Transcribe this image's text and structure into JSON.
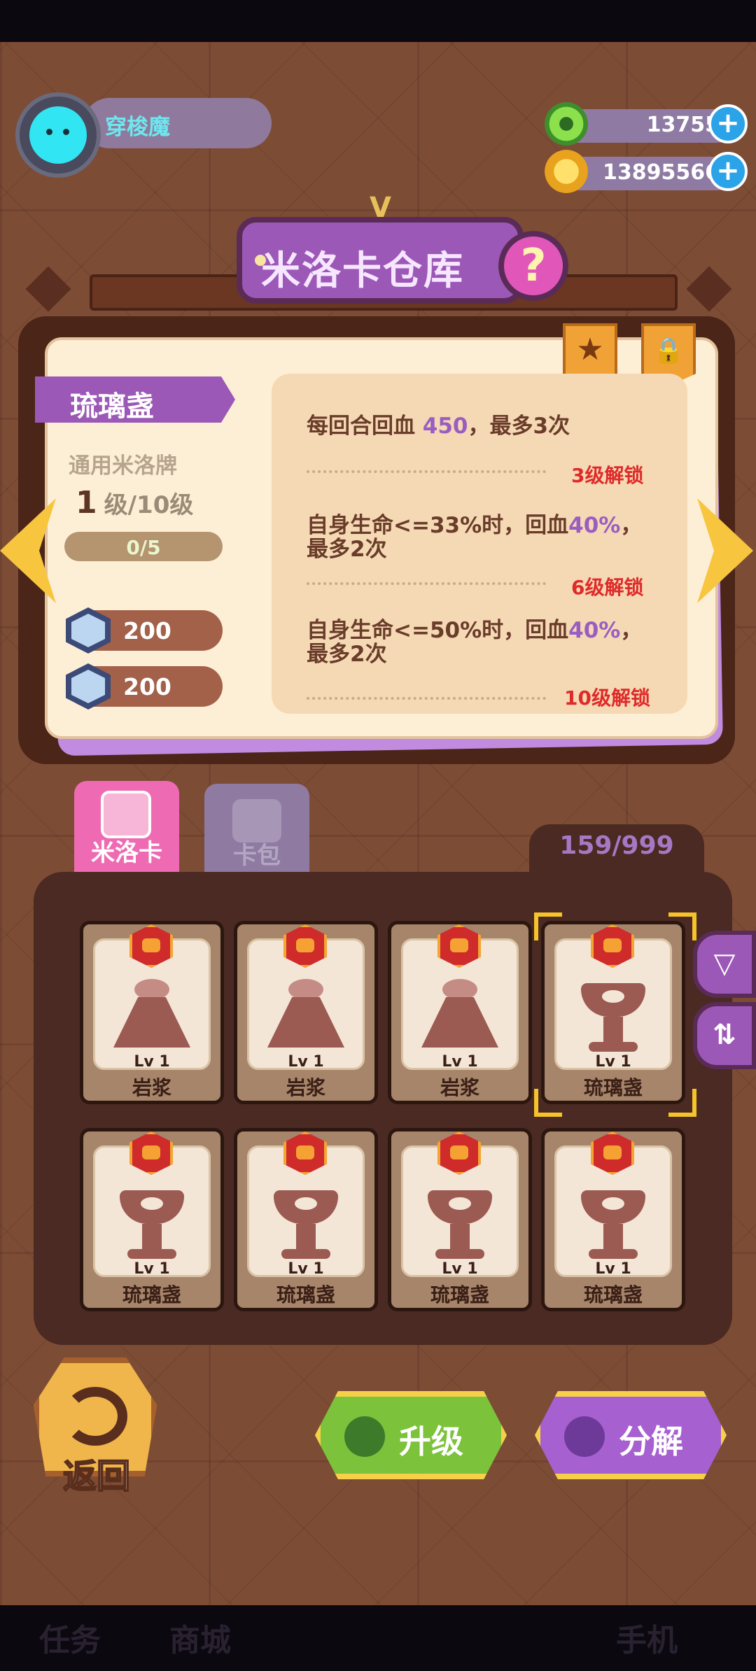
{
  "profile": {
    "name": "穿梭魔"
  },
  "currency": [
    {
      "icon": "green-gem-icon",
      "value": "13755"
    },
    {
      "icon": "gold-coin-icon",
      "value": "13895566"
    }
  ],
  "title": "米洛卡仓库",
  "help_label": "?",
  "detail": {
    "card_name": "琉璃盏",
    "type": "通用米洛牌",
    "level": "1",
    "level_suffix": "级/10级",
    "progress": "0/5",
    "progress_value": 0,
    "stats": [
      "200",
      "200"
    ],
    "skills": [
      {
        "parts": [
          "每回合回血 ",
          "450",
          "，最多3次"
        ],
        "unlock": "3级解锁"
      },
      {
        "parts": [
          "自身生命<=33%时，回血",
          "40%",
          "，最多2次"
        ],
        "unlock": "6级解锁"
      },
      {
        "parts": [
          "自身生命<=50%时，回血",
          "40%",
          "，最多2次"
        ],
        "unlock": "10级解锁"
      }
    ]
  },
  "tabs": [
    {
      "label": "米洛卡",
      "active": true
    },
    {
      "label": "卡包",
      "active": false
    }
  ],
  "count": "159/999",
  "inventory": [
    {
      "level": "Lv 1",
      "name": "岩浆",
      "art": "volcano",
      "selected": false
    },
    {
      "level": "Lv 1",
      "name": "岩浆",
      "art": "volcano",
      "selected": false
    },
    {
      "level": "Lv 1",
      "name": "岩浆",
      "art": "volcano",
      "selected": false
    },
    {
      "level": "Lv 1",
      "name": "琉璃盏",
      "art": "cup",
      "selected": true
    },
    {
      "level": "Lv 1",
      "name": "琉璃盏",
      "art": "cup",
      "selected": false
    },
    {
      "level": "Lv 1",
      "name": "琉璃盏",
      "art": "cup",
      "selected": false
    },
    {
      "level": "Lv 1",
      "name": "琉璃盏",
      "art": "cup",
      "selected": false
    },
    {
      "level": "Lv 1",
      "name": "琉璃盏",
      "art": "cup",
      "selected": false
    }
  ],
  "buttons": {
    "back": "返回",
    "upgrade": "升级",
    "decompose": "分解"
  },
  "bottom_nav": [
    "任务",
    "商城",
    "手机"
  ],
  "colors": {
    "accent_purple": "#9c58b6",
    "upgrade_green": "#7cc23a",
    "decompose_purple": "#a660d0",
    "gold": "#f7c53e"
  }
}
